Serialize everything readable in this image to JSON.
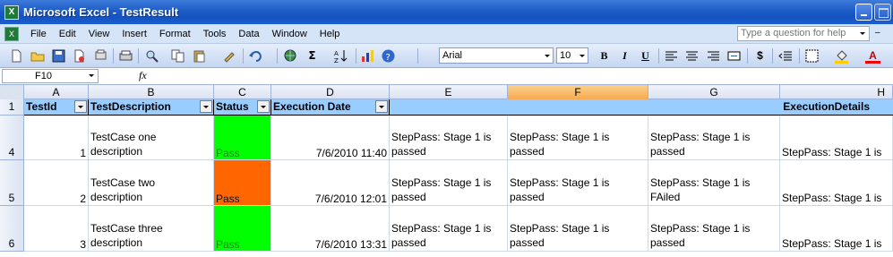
{
  "window": {
    "title": "Microsoft Excel - TestResult"
  },
  "menu": {
    "items": [
      "File",
      "Edit",
      "View",
      "Insert",
      "Format",
      "Tools",
      "Data",
      "Window",
      "Help"
    ],
    "help_placeholder": "Type a question for help"
  },
  "toolbar": {
    "font_name": "Arial",
    "font_size": "10",
    "bold": "B",
    "italic": "I",
    "underline": "U",
    "sum": "Σ",
    "currency": "$",
    "font_color_letter": "A"
  },
  "formula_bar": {
    "cell_ref": "F10",
    "fx": "fx"
  },
  "columns": [
    "A",
    "B",
    "C",
    "D",
    "E",
    "F",
    "G",
    "H"
  ],
  "selected_column": "F",
  "header_row": {
    "row": "1",
    "cells": [
      "TestId",
      "TestDescription",
      "Status",
      "Execution Date"
    ],
    "execution_details": "ExecutionDetails"
  },
  "rows": [
    {
      "row": "4",
      "id": "1",
      "desc_line1": "TestCase one",
      "desc_line2": "description",
      "status": "Pass",
      "date": "7/6/2010 11:40",
      "e1": "StepPass: Stage 1 is",
      "e2": "passed",
      "f1": "StepPass: Stage 1 is",
      "f2": "passed",
      "g1": "StepPass: Stage 1 is",
      "g2": "passed",
      "h": "StepPass: Stage 1 is"
    },
    {
      "row": "5",
      "id": "2",
      "desc_line1": "TestCase two",
      "desc_line2": "description",
      "status": "Pass",
      "date": "7/6/2010 12:01",
      "e1": "StepPass: Stage 1 is",
      "e2": "passed",
      "f1": "StepPass: Stage 1 is",
      "f2": "passed",
      "g1": "StepPass: Stage 1 is",
      "g2": "FAiled",
      "h": "StepPass: Stage 1 is"
    },
    {
      "row": "6",
      "id": "3",
      "desc_line1": "TestCase three",
      "desc_line2": "description",
      "status": "Pass",
      "date": "7/6/2010 13:31",
      "e1": "StepPass: Stage 1 is",
      "e2": "passed",
      "f1": "StepPass: Stage 1 is",
      "f2": "passed",
      "g1": "StepPass: Stage 1 is",
      "g2": "passed",
      "h": "StepPass: Stage 1 is"
    }
  ],
  "colors": {
    "header_fill": "#99ccff",
    "pass_green": "#00ff00",
    "status_orange": "#ff6600",
    "selected_col": "#f7a950"
  }
}
